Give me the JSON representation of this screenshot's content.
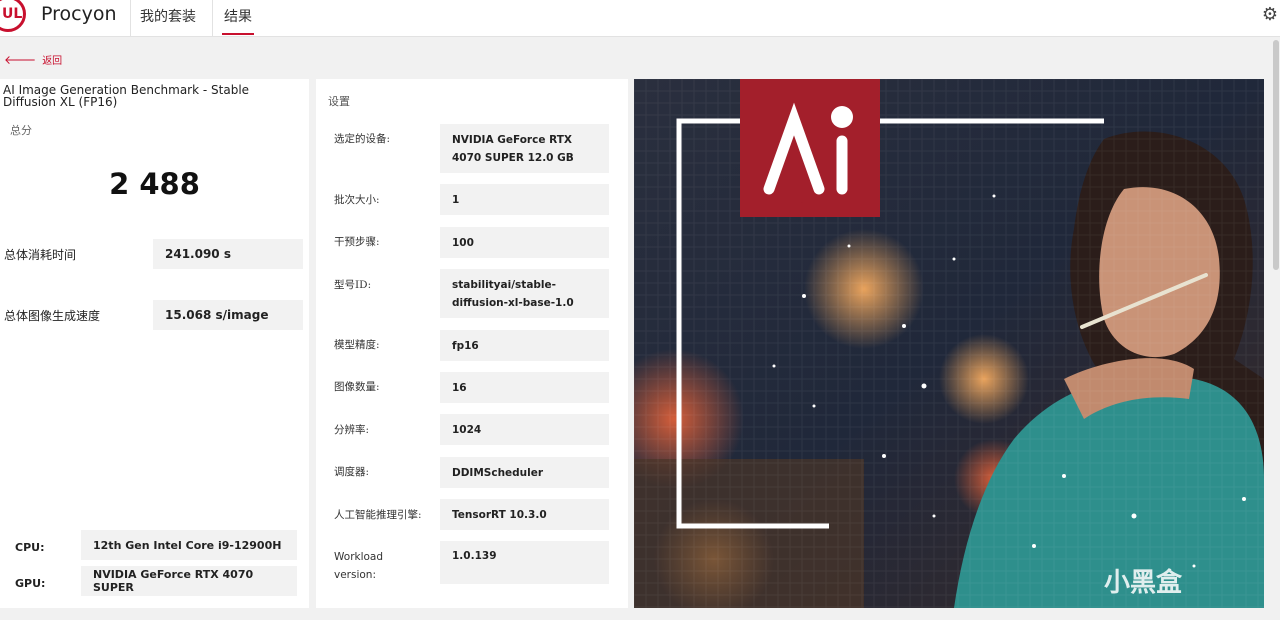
{
  "header": {
    "logo_text": "UL",
    "brand": "Procyon",
    "tabs": [
      {
        "label": "我的套装",
        "active": false
      },
      {
        "label": "结果",
        "active": true
      }
    ],
    "settings_icon": "gear-icon"
  },
  "back": {
    "label": "返回",
    "icon": "arrow-left-icon"
  },
  "result": {
    "title": "AI Image Generation Benchmark - Stable Diffusion XL (FP16)",
    "score_label": "总分",
    "score": "2 488",
    "metrics": [
      {
        "label": "总体消耗时间",
        "value": "241.090 s"
      },
      {
        "label": "总体图像生成速度",
        "value": "15.068 s/image"
      }
    ],
    "system": [
      {
        "label": "CPU:",
        "value": "12th Gen Intel Core i9-12900H"
      },
      {
        "label": "GPU:",
        "value": "NVIDIA GeForce RTX 4070 SUPER"
      }
    ]
  },
  "settings": {
    "title": "设置",
    "items": [
      {
        "label": "选定的设备:",
        "value": "NVIDIA GeForce RTX 4070 SUPER 12.0 GB"
      },
      {
        "label": "批次大小:",
        "value": "1"
      },
      {
        "label": "干预步骤:",
        "value": "100"
      },
      {
        "label": "型号ID:",
        "value": "stabilityai/stable-diffusion-xl-base-1.0"
      },
      {
        "label": "模型精度:",
        "value": "fp16"
      },
      {
        "label": "图像数量:",
        "value": "16"
      },
      {
        "label": "分辨率:",
        "value": "1024"
      },
      {
        "label": "调度器:",
        "value": "DDIMScheduler"
      },
      {
        "label": "人工智能推理引擎:",
        "value": "TensorRT 10.3.0"
      },
      {
        "label": "Workload version:",
        "value": "1.0.139"
      }
    ]
  },
  "hero": {
    "badge_text": "AI",
    "watermark": "小黑盒",
    "accent": "#a31f2b"
  },
  "colors": {
    "accent": "#c8102e"
  }
}
